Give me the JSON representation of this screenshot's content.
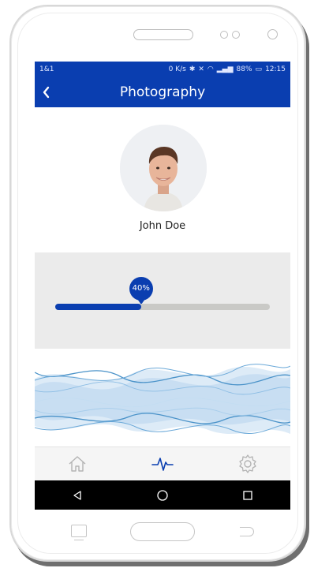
{
  "status": {
    "carrier": "1&1",
    "speed": "0 K/s",
    "battery": "88%",
    "time": "12:15"
  },
  "appbar": {
    "title": "Photography"
  },
  "profile": {
    "name": "John Doe"
  },
  "progress": {
    "value": 0.4,
    "label": "40%"
  },
  "tabs": [
    {
      "icon": "home-icon"
    },
    {
      "icon": "pulse-icon"
    },
    {
      "icon": "gear-icon"
    }
  ],
  "colors": {
    "primary": "#0a3eb0",
    "wave": "#4b93c9",
    "track": "#c9c9c6"
  }
}
